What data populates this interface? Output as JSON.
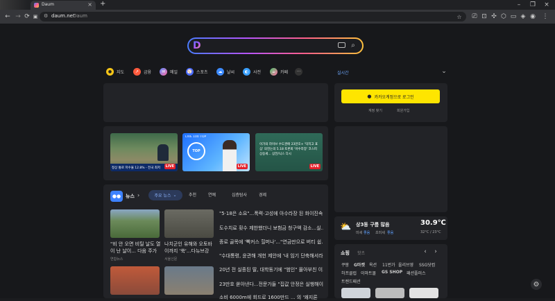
{
  "browser": {
    "tab_title": "Daum",
    "new_tab": "+",
    "url": "daum.net",
    "url_site": "Daum"
  },
  "search": {
    "logo_letter": "D"
  },
  "shortcuts": [
    {
      "label": "지도",
      "color": "#f5c518"
    },
    {
      "label": "금융",
      "color": "#ff5a3d"
    },
    {
      "label": "메일",
      "color": "#5b8cff"
    },
    {
      "label": "스포츠",
      "color": "#4a6cff"
    },
    {
      "label": "날씨",
      "color": "#3d8bff"
    },
    {
      "label": "사전",
      "color": "#3aa0ff"
    },
    {
      "label": "카페",
      "color": "#4ac46a"
    }
  ],
  "realtime_label": "실시간",
  "login": {
    "button": "카카오계정으로 로그인",
    "find": "계정 찾기",
    "signup": "회원가입"
  },
  "media": [
    {
      "caption": "정상 통로 저수율 12.8% - 전국 최저",
      "live": "LIVE"
    },
    {
      "caption": "LIVE 100 TOP",
      "live": "LIVE"
    },
    {
      "caption": "이가의 라이브 수도권에 23만호+ '덕지고 표심' 의힌는의 5.18 토론회 '아수라장' 코스피 상승세... 삼전/닉스 다시",
      "live": "LIVE"
    }
  ],
  "news": {
    "title": "뉴스",
    "tabs": [
      "주요 뉴스",
      "추천",
      "연예",
      "심층탐사",
      "경제"
    ],
    "cards": [
      {
        "caption": "\"비 안 오면 비틸 날도 열이 난 날이... 다음 주가 ...",
        "source": "연합뉴스"
      },
      {
        "caption": "나치군인 유해와 오토바이까지 '쑥'...다뉴브강 ...",
        "source": "서울신문"
      }
    ],
    "headlines": [
      "\"5·18은 소요\"...폭력·고성에 아수라장 된 화이진속 ...",
      "도수치료 횟수 제한했더니 보험금 청구액 감소...실...",
      "종로 골목에 '빡커스 힐머나'...\"연금만으로 버티 쉽...",
      "\"수대통령, 윤관해 개헌 제안에 '내 임기 단축해서라...",
      "20년 전 실종된 딸, 대학동기에 \"범인\" 몰아부친 이...",
      "23만호 쏟아낸다...전문가들 \"집값 안정은 실행해이...",
      "소비 6000m에 회드로 1600만드 ... 의 '왜지론"
    ]
  },
  "weather": {
    "desc": "상3동 구름 많음",
    "fine_dust_label": "미세",
    "fine_dust": "좋음",
    "ultra_label": "초미세",
    "ultra": "좋음",
    "temp": "30.9℃",
    "range": "32°C / 23°C"
  },
  "shopping": {
    "title": "쇼핑",
    "sub": "핫츠",
    "row1": [
      "쿠팡",
      "G마켓",
      "옥션",
      "11번가",
      "올리브영",
      "SSG닷컴"
    ],
    "row2": [
      "하프클럽",
      "이마트몰",
      "GS SHOP",
      "패션플러스"
    ],
    "row3": [
      "트렌드패션"
    ]
  }
}
